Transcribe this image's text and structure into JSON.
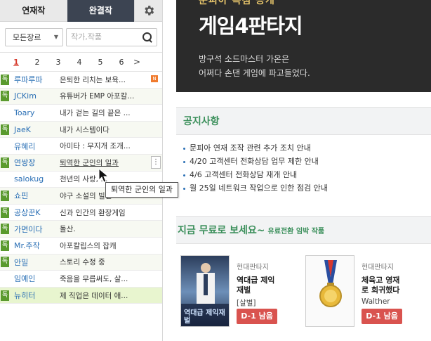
{
  "sidebar": {
    "tabs": [
      "연재작",
      "완결작"
    ],
    "genre_select": "모든장르",
    "search_placeholder": "작가,작품",
    "pages": [
      "1",
      "2",
      "3",
      "4",
      "5",
      "6"
    ],
    "next": ">",
    "rows": [
      {
        "badge": "독",
        "author": "루파루파",
        "title": "은퇴한 리치는 보육...",
        "new": "N"
      },
      {
        "badge": "독",
        "author": "JCKim",
        "title": "유튜버가 EMP 아포칼..."
      },
      {
        "badge": "",
        "author": "Toary",
        "title": "내가 걷는 길의 끝은 ..."
      },
      {
        "badge": "독",
        "author": "JaeK",
        "title": "내가 시스템이다"
      },
      {
        "badge": "",
        "author": "유혜리",
        "title": "아미타 : 무지개 조개..."
      },
      {
        "badge": "독",
        "author": "연쌍장",
        "title": "퇴역한 군인의 일과"
      },
      {
        "badge": "",
        "author": "salokug",
        "title": "천년의 사랑,  ..."
      },
      {
        "badge": "독",
        "author": "쇼핀",
        "title": "야구 소설의 빌런"
      },
      {
        "badge": "독",
        "author": "공상꾼K",
        "title": "신과 인간의 환장게임"
      },
      {
        "badge": "독",
        "author": "가면이다",
        "title": "돌산."
      },
      {
        "badge": "독",
        "author": "Mr.주작",
        "title": "아포칼립스의 잡캐"
      },
      {
        "badge": "독",
        "author": "안밀",
        "title": "스토리 수정 중"
      },
      {
        "badge": "",
        "author": "임예인",
        "title": "죽음을 무릅써도, 살..."
      },
      {
        "badge": "독",
        "author": "뉴히터",
        "title": "제 직업은 데이터 애..."
      }
    ],
    "more_label": "⋮",
    "tooltip": "퇴역한 군인의 일과"
  },
  "banner": {
    "top": "문피아 독점 공개",
    "headline": "게임4판타지",
    "desc_line1": "방구석 소드마스터 가온은",
    "desc_line2": "어쩌다 손댄 게임에 파고들었다."
  },
  "notice": {
    "heading": "공지사항",
    "items": [
      "문피아 연재 조작 관련 추가 조치 안내",
      "4/20 고객센터 전화상담 업무 제한 안내",
      "4/6 고객센터 전화상담 재개 안내",
      "월 25일 네트워크 작업으로 인한 점검 안내"
    ]
  },
  "free": {
    "heading": "지금 무료로 보세요~",
    "sub": "유료전환 임박 작품",
    "books": [
      {
        "genre": "현대판타지",
        "title_l1": "역대급  제익",
        "title_l2": "재벌",
        "author": "[살별]",
        "dday": "D-1 남음",
        "cover_text": "역대급 제익재벌"
      },
      {
        "genre": "현대판타지",
        "title_l1": "체육고  영재",
        "title_l2": "로 회귀했다",
        "author": "Walther",
        "dday": "D-1 남음"
      }
    ]
  },
  "colors": {
    "accent_green": "#3a8f5a",
    "dark_tab": "#3c4452",
    "dday_red": "#d9534f",
    "badge_green": "#5a9a2e"
  }
}
